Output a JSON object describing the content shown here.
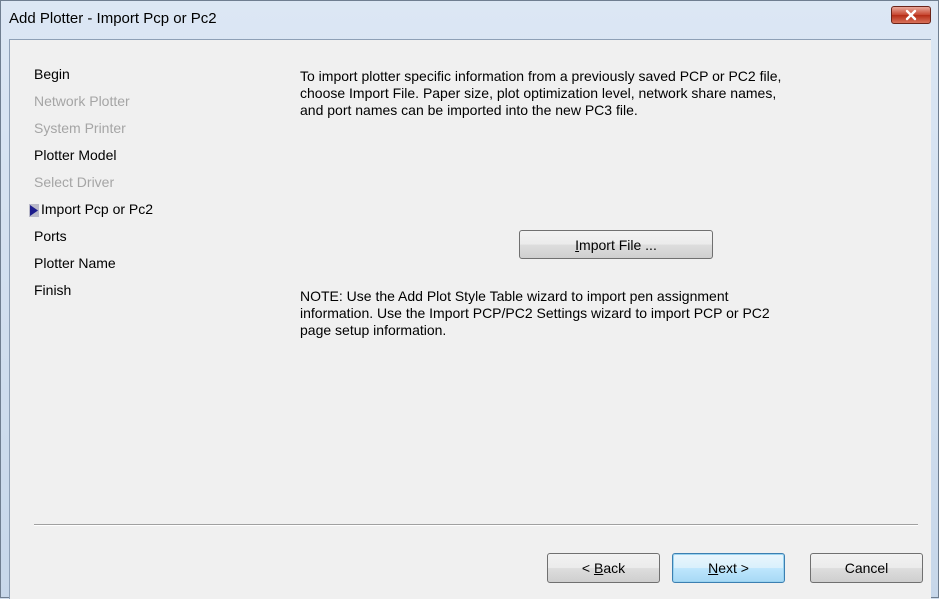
{
  "window": {
    "title": "Add Plotter - Import Pcp or Pc2"
  },
  "steps": [
    {
      "label": "Begin",
      "state": "enabled"
    },
    {
      "label": "Network Plotter",
      "state": "disabled"
    },
    {
      "label": "System Printer",
      "state": "disabled"
    },
    {
      "label": "Plotter Model",
      "state": "enabled"
    },
    {
      "label": "Select Driver",
      "state": "disabled"
    },
    {
      "label": "Import Pcp or Pc2",
      "state": "current"
    },
    {
      "label": "Ports",
      "state": "enabled"
    },
    {
      "label": "Plotter Name",
      "state": "enabled"
    },
    {
      "label": "Finish",
      "state": "enabled"
    }
  ],
  "content": {
    "intro_text": "To import plotter specific information from a previously saved PCP or PC2 file, choose Import File. Paper size, plot optimization level, network share names, and port names can be imported into the new PC3 file.",
    "import_button": {
      "mnemonic": "I",
      "rest": "mport File ..."
    },
    "note_text": "NOTE: Use the Add Plot Style Table wizard to import pen assignment information. Use the Import PCP/PC2 Settings wizard to import PCP or PC2 page setup information."
  },
  "buttons": {
    "back": {
      "prefix": "< ",
      "mnemonic": "B",
      "rest": "ack"
    },
    "next": {
      "mnemonic": "N",
      "rest": "ext >"
    },
    "cancel": "Cancel"
  },
  "colors": {
    "close_button": "#c7452f",
    "current_step_arrow": "#1c1c8c",
    "disabled_text": "#a5a5a5",
    "default_button_border": "#3c7fb1"
  },
  "icons": {
    "close": "close-icon",
    "current_step": "current-step-arrow-icon"
  }
}
